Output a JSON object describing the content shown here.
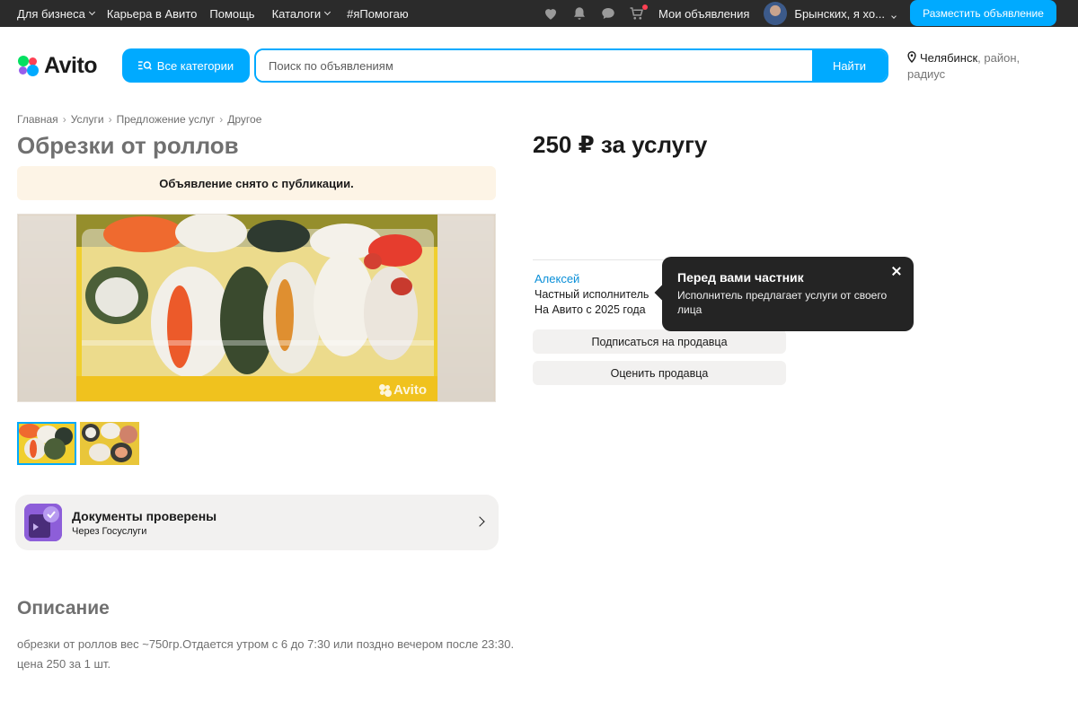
{
  "topbar": {
    "nav": [
      {
        "label": "Для бизнеса",
        "dropdown": true
      },
      {
        "label": "Карьера в Авито",
        "dropdown": false
      },
      {
        "label": "Помощь",
        "dropdown": false
      },
      {
        "label": "Каталоги",
        "dropdown": true
      },
      {
        "label": "#яПомогаю",
        "dropdown": false
      }
    ],
    "icons": [
      "heart-icon",
      "bell-icon",
      "chat-icon",
      "cart-icon"
    ],
    "my_ads": "Мои объявления",
    "username": "Брынских, я хо...",
    "post_button": "Разместить объявление"
  },
  "header": {
    "logo_text": "Avito",
    "categories_button": "Все категории",
    "search_placeholder": "Поиск по объявлениям",
    "search_button": "Найти",
    "location_city": "Челябинск",
    "location_rest": ", район, радиус"
  },
  "breadcrumb": [
    "Главная",
    "Услуги",
    "Предложение услуг",
    "Другое"
  ],
  "listing": {
    "title": "Обрезки от роллов",
    "notice": "Объявление снято с публикации.",
    "watermark": "Avito",
    "price": "250 ₽ за услугу"
  },
  "docs": {
    "title": "Документы проверены",
    "subtitle": "Через Госуслуги"
  },
  "description": {
    "heading": "Описание",
    "text": "обрезки от роллов вес ~750гр.Отдается утром с 6 до 7:30 или поздно вечером после 23:30. цена 250 за 1 шт."
  },
  "seller": {
    "name": "Алексей",
    "type": "Частный исполнитель",
    "since": "На Авито с 2025 года",
    "subscribe_button": "Подписаться на продавца",
    "rate_button": "Оценить продавца"
  },
  "tooltip": {
    "title": "Перед вами частник",
    "body": "Исполнитель предлагает услуги от своего лица"
  },
  "colors": {
    "accent": "#00aaff",
    "topbar": "#2b2b2b",
    "notice_bg": "#fdf4e6",
    "link": "#0a8fd8"
  }
}
